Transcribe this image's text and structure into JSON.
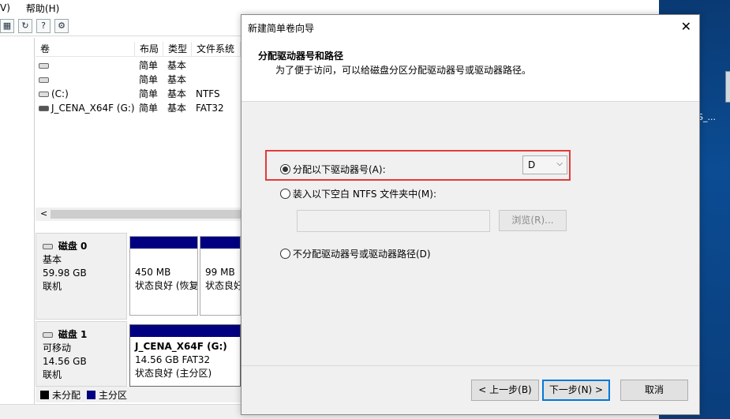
{
  "menu": {
    "item1": "V)",
    "item2": "帮助(H)"
  },
  "toolbar": {
    "icons": [
      "properties-icon",
      "refresh-icon",
      "help-icon",
      "settings-icon"
    ]
  },
  "volumes": {
    "headers": [
      "卷",
      "布局",
      "类型",
      "文件系统"
    ],
    "rows": [
      {
        "name": "",
        "layout": "简单",
        "type": "基本",
        "fs": ""
      },
      {
        "name": "",
        "layout": "简单",
        "type": "基本",
        "fs": ""
      },
      {
        "name": "(C:)",
        "layout": "简单",
        "type": "基本",
        "fs": "NTFS"
      },
      {
        "name": "J_CENA_X64F (G:)",
        "layout": "简单",
        "type": "基本",
        "fs": "FAT32"
      }
    ]
  },
  "disks": [
    {
      "name": "磁盘 0",
      "kind": "基本",
      "size": "59.98 GB",
      "status": "联机",
      "partitions": [
        {
          "title": "",
          "size": "450 MB",
          "state": "状态良好 (恢复"
        },
        {
          "title": "",
          "size": "99 MB",
          "state": "状态良好"
        }
      ]
    },
    {
      "name": "磁盘 1",
      "kind": "可移动",
      "size": "14.56 GB",
      "status": "联机",
      "partitions": [
        {
          "title": "J_CENA_X64F  (G:)",
          "size": "14.56 GB FAT32",
          "state": "状态良好 (主分区)"
        }
      ]
    }
  ],
  "legend": {
    "unallocated": "未分配",
    "primary": "主分区",
    "colors": {
      "unallocated": "#000000",
      "primary": "#000080"
    }
  },
  "desktop": {
    "icon_label": "S_..."
  },
  "dialog": {
    "title": "新建简单卷向导",
    "heading": "分配驱动器号和路径",
    "subheading": "为了便于访问，可以给磁盘分区分配驱动器号或驱动器路径。",
    "option_assign": "分配以下驱动器号(A):",
    "drive_letter": "D",
    "option_mount": "装入以下空白 NTFS 文件夹中(M):",
    "browse": "浏览(R)...",
    "option_none": "不分配驱动器号或驱动器路径(D)",
    "back": "< 上一步(B)",
    "next": "下一步(N) >",
    "cancel": "取消",
    "highlight_color": "#e23b3b"
  }
}
